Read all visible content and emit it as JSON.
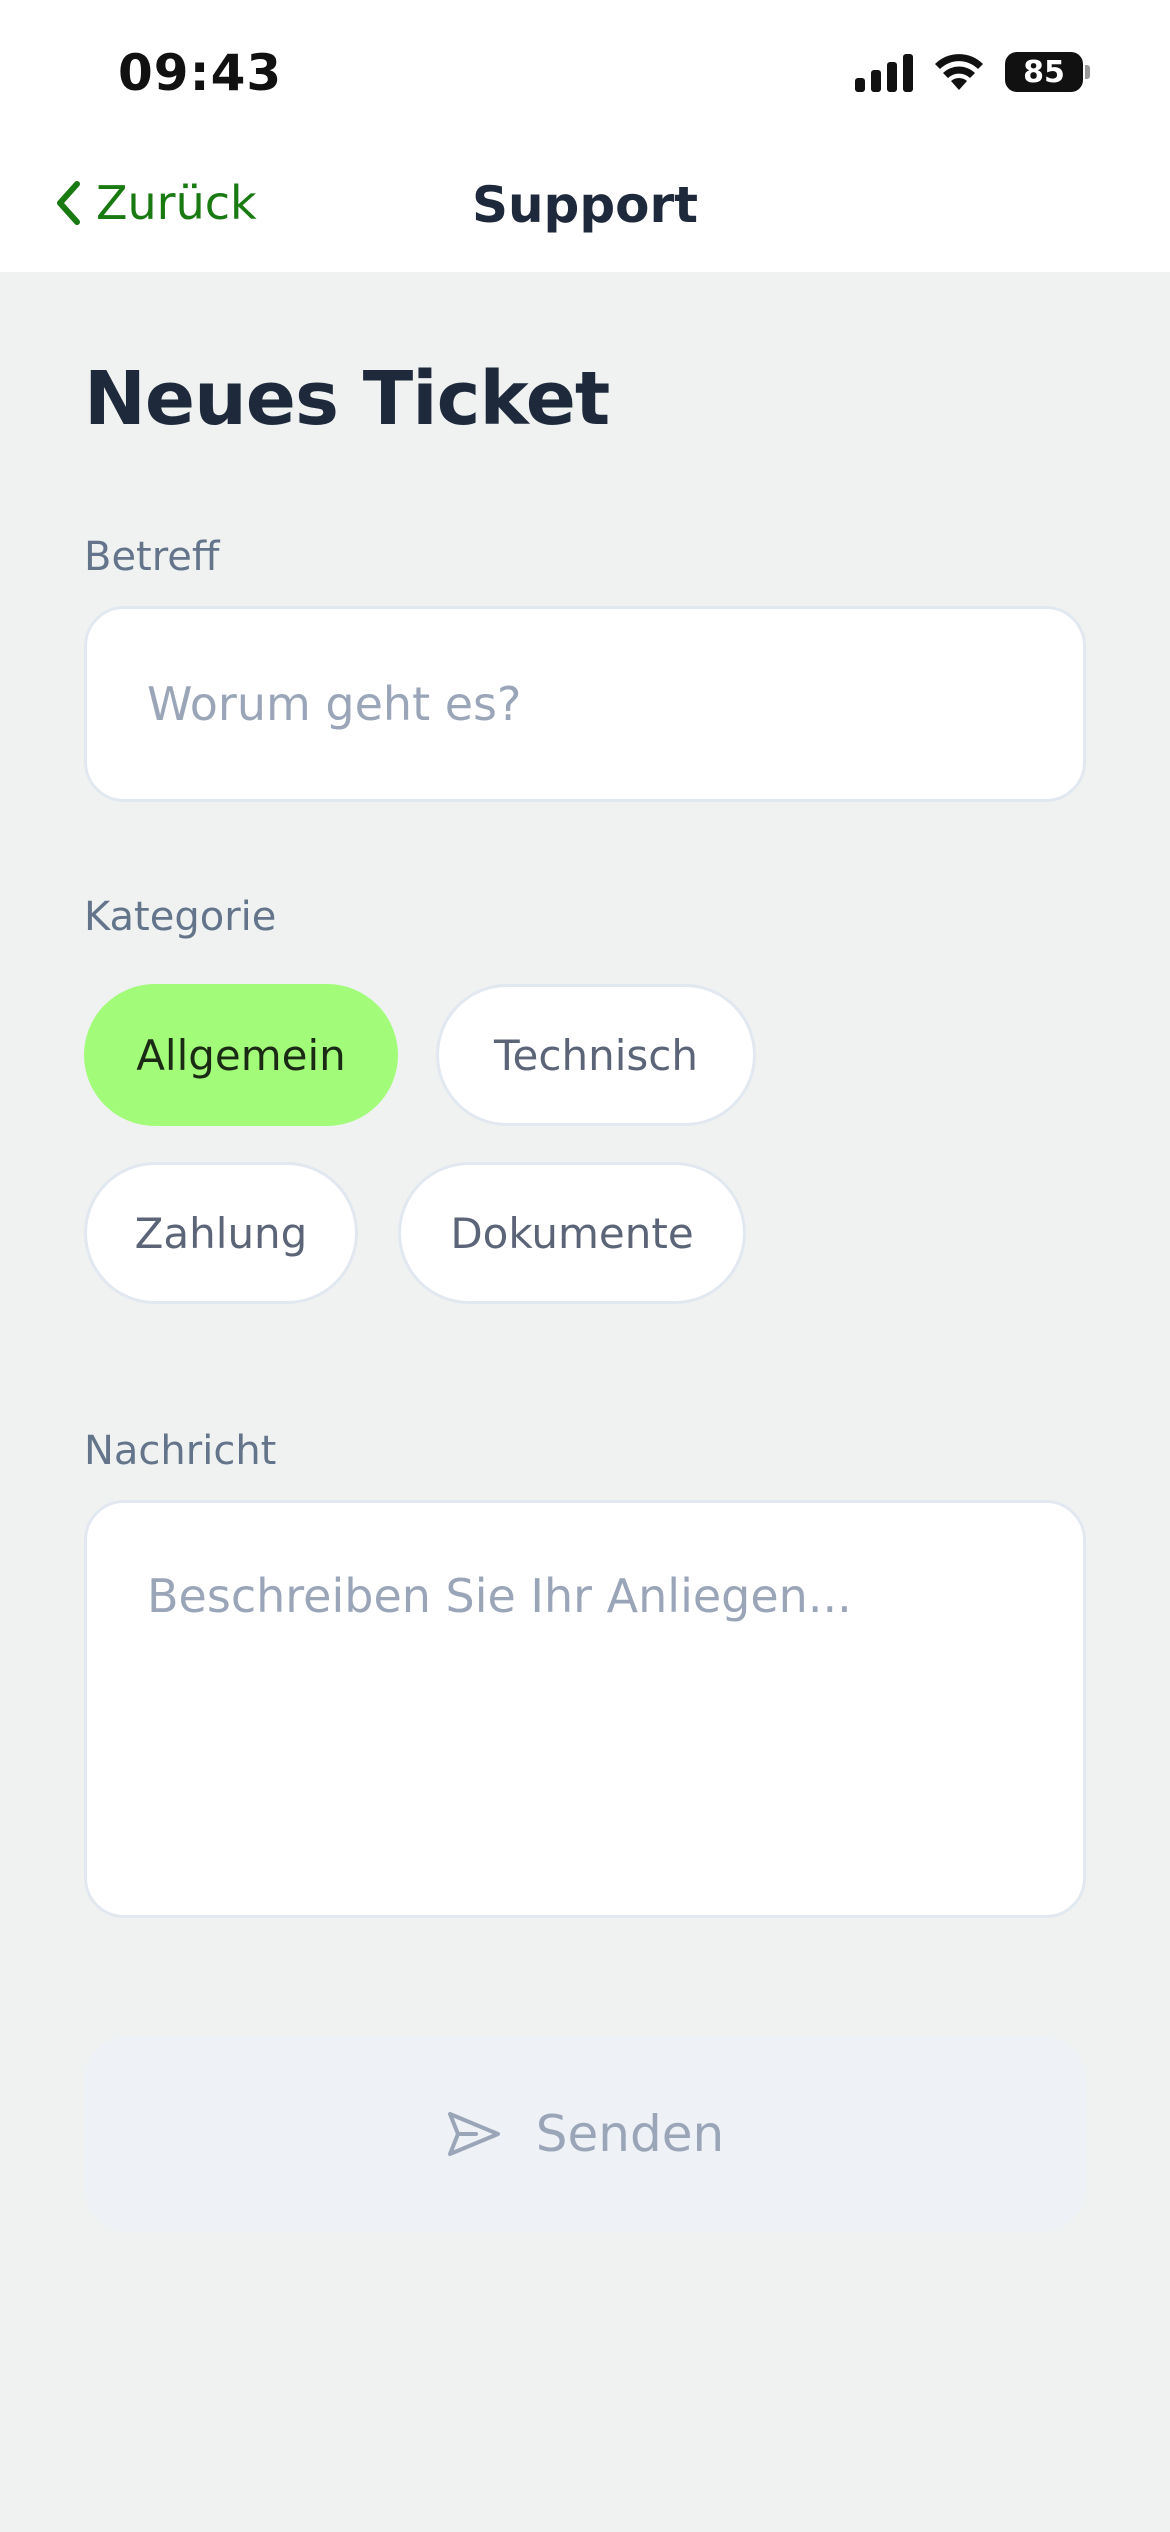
{
  "status_bar": {
    "time": "09:43",
    "battery": "85",
    "icons": [
      "cellular-signal-icon",
      "wifi-icon",
      "battery-icon"
    ]
  },
  "nav": {
    "back_label": "Zurück",
    "title": "Support"
  },
  "form": {
    "title": "Neues Ticket",
    "subject": {
      "label": "Betreff",
      "placeholder": "Worum geht es?",
      "value": ""
    },
    "category": {
      "label": "Kategorie",
      "options": [
        "Allgemein",
        "Technisch",
        "Zahlung",
        "Dokumente"
      ],
      "selected": "Allgemein"
    },
    "message": {
      "label": "Nachricht",
      "placeholder": "Beschreiben Sie Ihr Anliegen...",
      "value": ""
    },
    "submit_label": "Senden"
  },
  "colors": {
    "accent_green": "#1a7a12",
    "chip_active": "#a3fb7a",
    "background": "#eff2f1"
  }
}
